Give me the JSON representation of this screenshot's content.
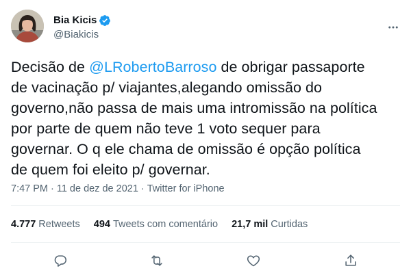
{
  "author": {
    "display_name": "Bia Kicis",
    "handle": "@Biakicis",
    "verified": true,
    "avatar_icon": "profile-photo"
  },
  "tweet": {
    "lines": [
      {
        "before": "Decisão de ",
        "mention": "@LRobertoBarroso",
        "after": " de obrigar passaporte"
      },
      {
        "text": "de vacinação p/ viajantes,alegando omissão do"
      },
      {
        "text": "governo,não passa de mais uma intromissão na política"
      },
      {
        "text": "por parte de quem não teve 1 voto sequer para"
      },
      {
        "text": "governar. O q ele chama de omissão é opção política"
      },
      {
        "text": "de quem foi eleito p/ governar."
      }
    ]
  },
  "meta": {
    "time": "7:47 PM",
    "separator": "·",
    "date": "11 de dez de 2021",
    "source": "Twitter for iPhone"
  },
  "stats": {
    "retweets_count": "4.777",
    "retweets_label": "Retweets",
    "quotes_count": "494",
    "quotes_label": "Tweets com comentário",
    "likes_count": "21,7 mil",
    "likes_label": "Curtidas"
  },
  "actions": [
    "reply-icon",
    "retweet-icon",
    "like-icon",
    "share-icon"
  ],
  "colors": {
    "accent": "#1d9bf0",
    "text": "#0f1419",
    "secondary": "#536471",
    "divider": "#eff3f4"
  }
}
